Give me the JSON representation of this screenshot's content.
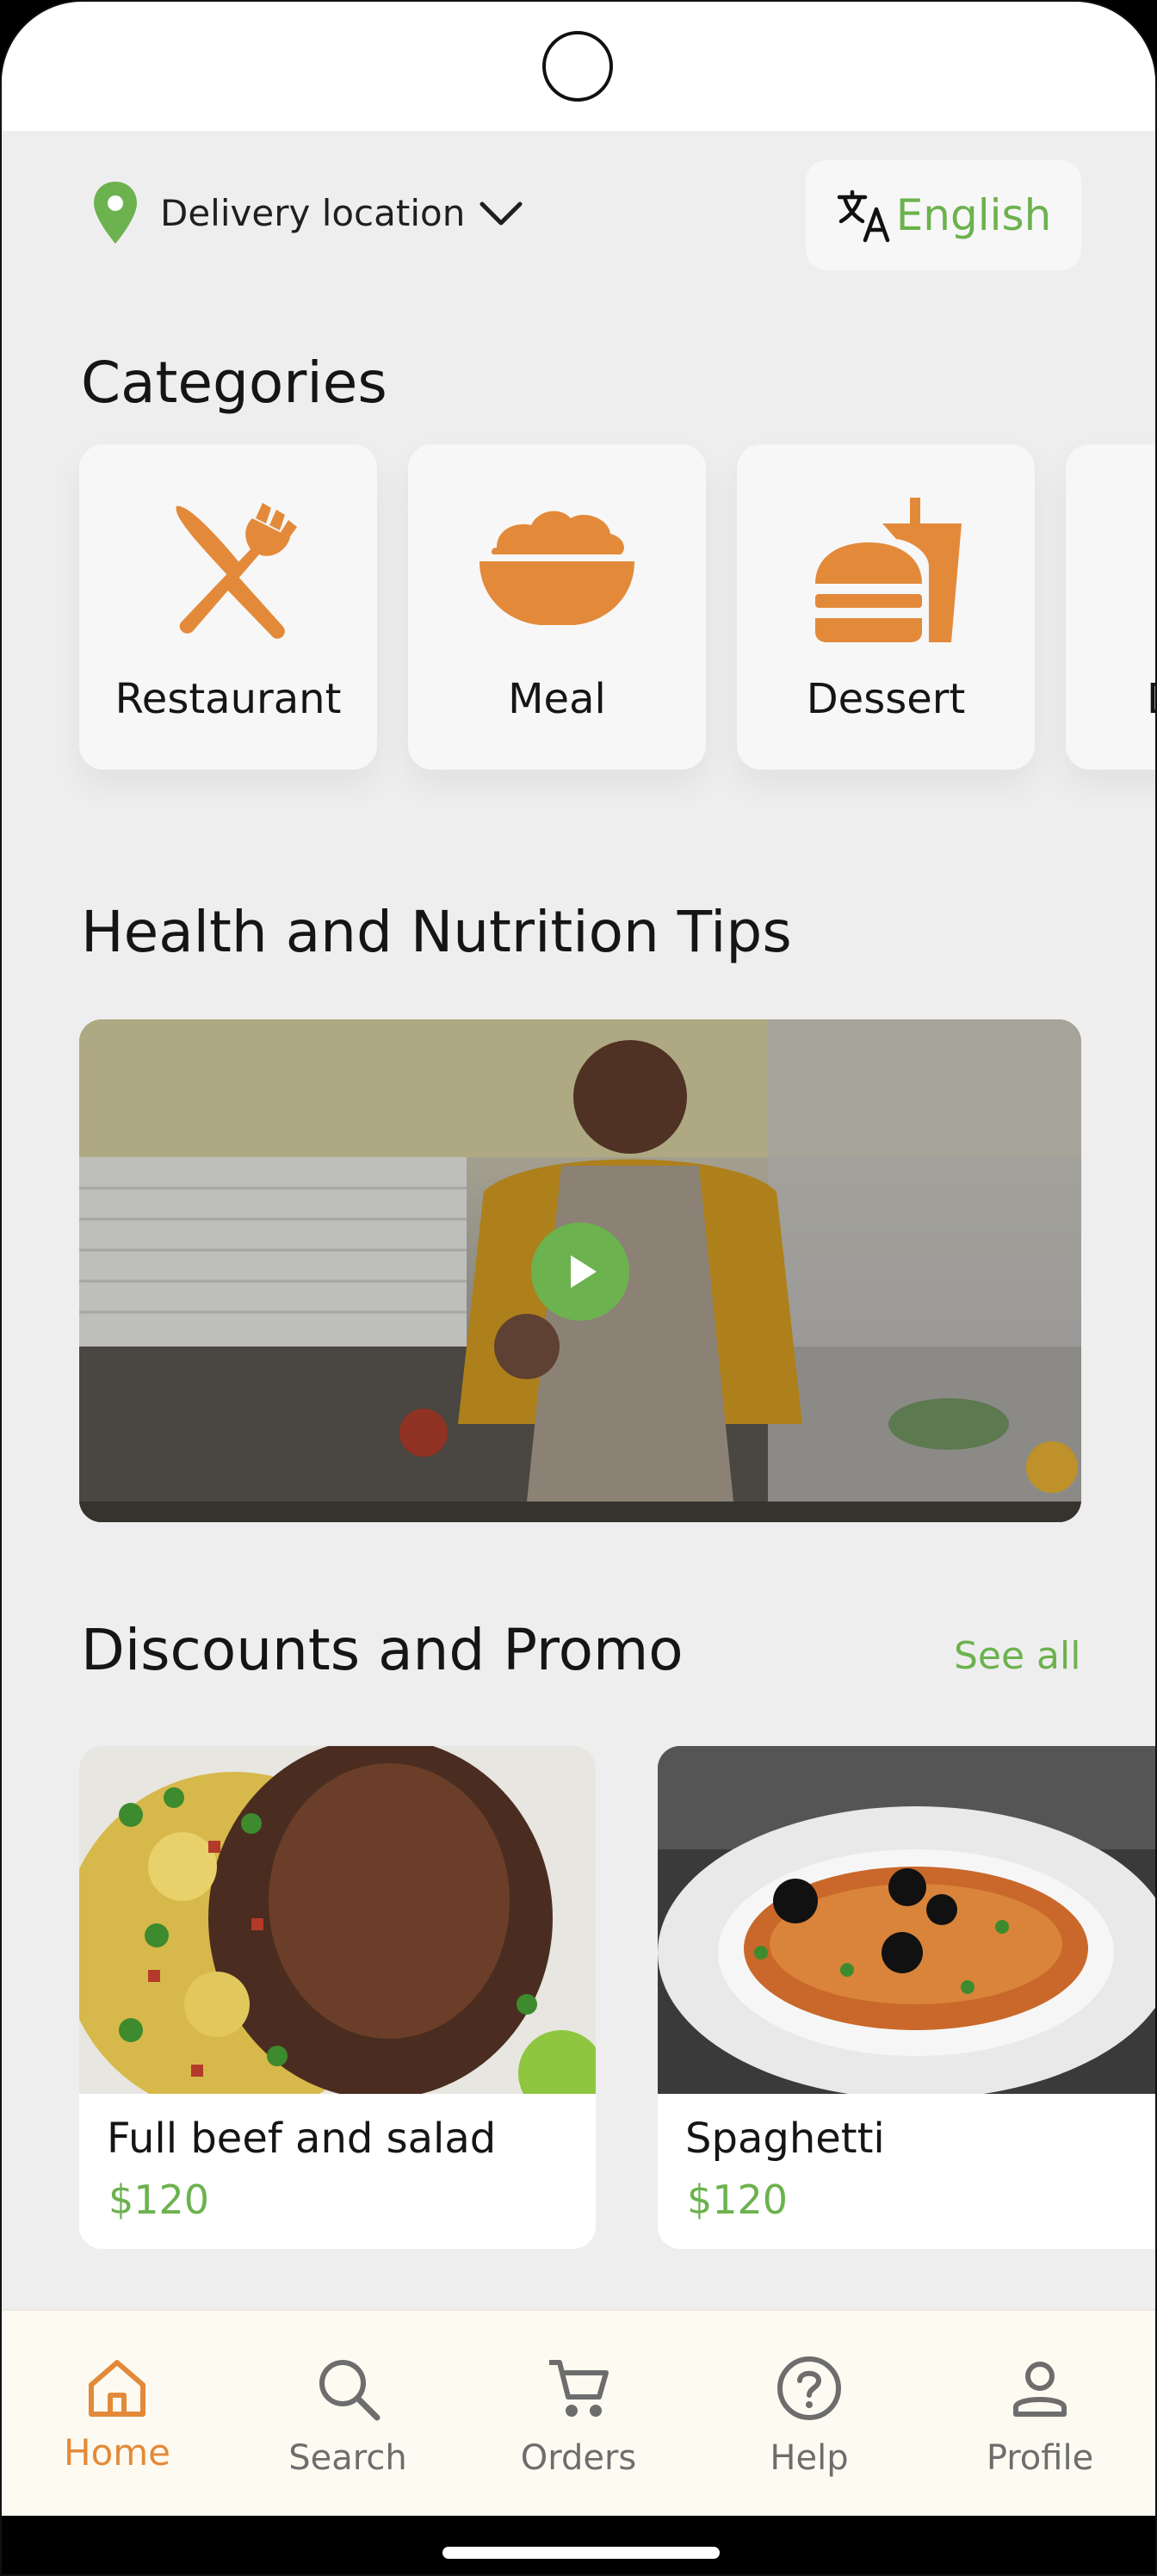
{
  "header": {
    "location_label": "Delivery location",
    "language_label": "English"
  },
  "categories": {
    "title": "Categories",
    "items": [
      {
        "label": "Restaurant",
        "icon": "fork-knife-icon"
      },
      {
        "label": "Meal",
        "icon": "bowl-icon"
      },
      {
        "label": "Dessert",
        "icon": "burger-drink-icon"
      },
      {
        "label": "D",
        "icon": "category-icon"
      }
    ]
  },
  "tips": {
    "title": "Health and Nutrition Tips"
  },
  "promo": {
    "title": "Discounts and Promo",
    "see_all": "See all",
    "items": [
      {
        "name": "Full beef and salad",
        "price": "$120"
      },
      {
        "name": "Spaghetti",
        "price": "$120"
      }
    ]
  },
  "nav": {
    "items": [
      {
        "label": "Home",
        "icon": "home-icon",
        "active": true
      },
      {
        "label": "Search",
        "icon": "search-icon",
        "active": false
      },
      {
        "label": "Orders",
        "icon": "cart-icon",
        "active": false
      },
      {
        "label": "Help",
        "icon": "help-icon",
        "active": false
      },
      {
        "label": "Profile",
        "icon": "profile-icon",
        "active": false
      }
    ]
  },
  "colors": {
    "accent_green": "#6cb24f",
    "accent_orange": "#e38a3a",
    "background": "#efeeef"
  }
}
